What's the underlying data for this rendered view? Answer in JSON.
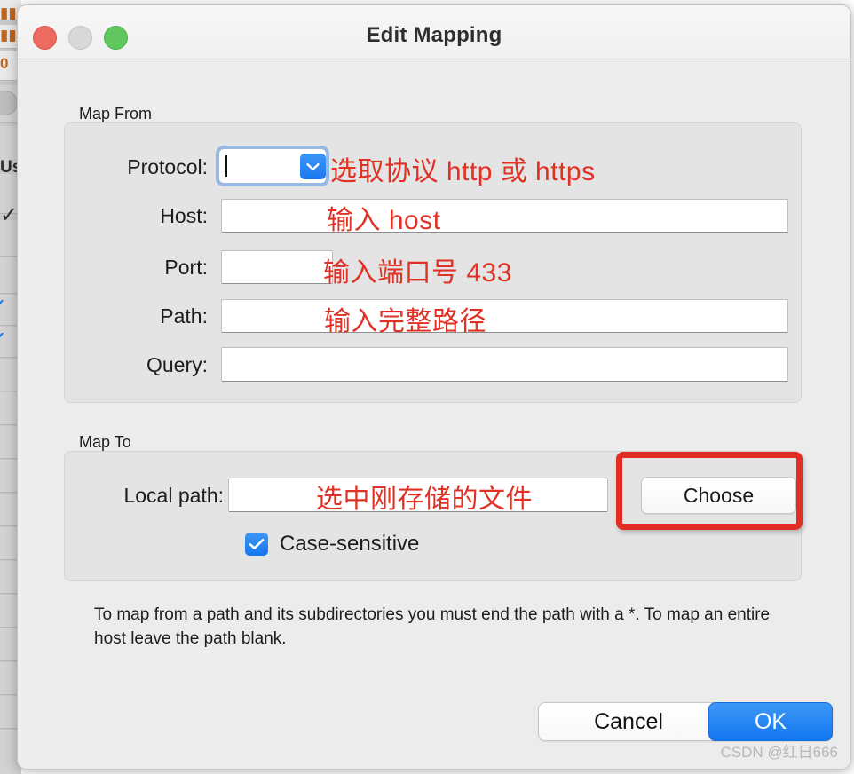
{
  "window": {
    "title": "Edit Mapping",
    "controls": {
      "close": "close-button",
      "minimize": "minimize-button",
      "maximize": "maximize-button"
    }
  },
  "map_from": {
    "group_label": "Map From",
    "fields": [
      {
        "label": "Protocol:",
        "value": "",
        "annotation": "选取协议 http 或 https"
      },
      {
        "label": "Host:",
        "value": "",
        "annotation": "输入 host"
      },
      {
        "label": "Port:",
        "value": "",
        "annotation": "输入端口号 433"
      },
      {
        "label": "Path:",
        "value": "",
        "annotation": "输入完整路径"
      },
      {
        "label": "Query:",
        "value": "",
        "annotation": ""
      }
    ]
  },
  "map_to": {
    "group_label": "Map To",
    "local_path": {
      "label": "Local path:",
      "value": "",
      "annotation": "选中刚存储的文件"
    },
    "choose_button": "Choose",
    "case_sensitive": {
      "label": "Case-sensitive",
      "checked": true,
      "checkmark": "✓"
    }
  },
  "help_text": "To map from a path and its subdirectories you must end the path with a *. To map an entire host leave the path blank.",
  "footer": {
    "cancel_label": "Cancel",
    "ok_label": "OK"
  },
  "watermark": "CSDN @红日666",
  "background_window": {
    "fragments": [
      "0",
      "Us",
      "✓"
    ]
  },
  "colors": {
    "accent_blue": "#1b79ef",
    "annotation_red": "#e03125",
    "highlight_red": "#e22d22",
    "close_red": "#ec6a5f",
    "maximize_green": "#5fc75d",
    "window_bg": "#ececec",
    "group_bg": "#e4e4e4"
  }
}
